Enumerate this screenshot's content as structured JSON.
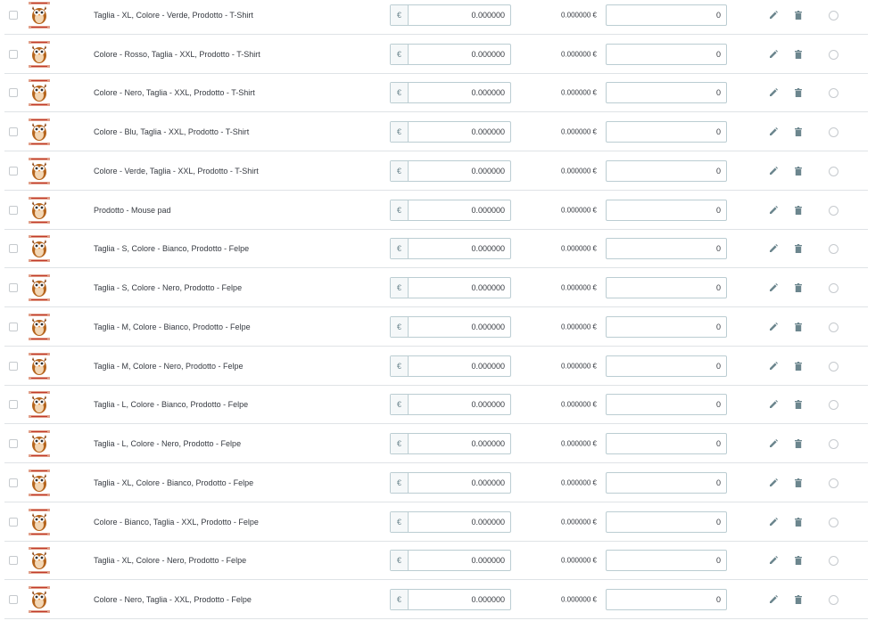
{
  "currency_symbol": "€",
  "rows": [
    {
      "name": "Taglia - XL, Colore - Verde, Prodotto - T-Shirt",
      "impact": "0.000000",
      "final": "0.000000 €",
      "qty": "0"
    },
    {
      "name": "Colore - Rosso, Taglia - XXL, Prodotto - T-Shirt",
      "impact": "0.000000",
      "final": "0.000000 €",
      "qty": "0"
    },
    {
      "name": "Colore - Nero, Taglia - XXL, Prodotto - T-Shirt",
      "impact": "0.000000",
      "final": "0.000000 €",
      "qty": "0"
    },
    {
      "name": "Colore - Blu, Taglia - XXL, Prodotto - T-Shirt",
      "impact": "0.000000",
      "final": "0.000000 €",
      "qty": "0"
    },
    {
      "name": "Colore - Verde, Taglia - XXL, Prodotto - T-Shirt",
      "impact": "0.000000",
      "final": "0.000000 €",
      "qty": "0"
    },
    {
      "name": "Prodotto - Mouse pad",
      "impact": "0.000000",
      "final": "0.000000 €",
      "qty": "0"
    },
    {
      "name": "Taglia - S, Colore - Bianco, Prodotto - Felpe",
      "impact": "0.000000",
      "final": "0.000000 €",
      "qty": "0"
    },
    {
      "name": "Taglia - S, Colore - Nero, Prodotto - Felpe",
      "impact": "0.000000",
      "final": "0.000000 €",
      "qty": "0"
    },
    {
      "name": "Taglia - M, Colore - Bianco, Prodotto - Felpe",
      "impact": "0.000000",
      "final": "0.000000 €",
      "qty": "0"
    },
    {
      "name": "Taglia - M, Colore - Nero, Prodotto - Felpe",
      "impact": "0.000000",
      "final": "0.000000 €",
      "qty": "0"
    },
    {
      "name": "Taglia - L, Colore - Bianco, Prodotto - Felpe",
      "impact": "0.000000",
      "final": "0.000000 €",
      "qty": "0"
    },
    {
      "name": "Taglia - L, Colore - Nero, Prodotto - Felpe",
      "impact": "0.000000",
      "final": "0.000000 €",
      "qty": "0"
    },
    {
      "name": "Taglia - XL, Colore - Bianco, Prodotto - Felpe",
      "impact": "0.000000",
      "final": "0.000000 €",
      "qty": "0"
    },
    {
      "name": "Colore - Bianco, Taglia - XXL, Prodotto - Felpe",
      "impact": "0.000000",
      "final": "0.000000 €",
      "qty": "0"
    },
    {
      "name": "Taglia - XL, Colore - Nero, Prodotto - Felpe",
      "impact": "0.000000",
      "final": "0.000000 €",
      "qty": "0"
    },
    {
      "name": "Colore - Nero, Taglia - XXL, Prodotto - Felpe",
      "impact": "0.000000",
      "final": "0.000000 €",
      "qty": "0"
    }
  ],
  "icons": {
    "thumbnail": "owl-product-image",
    "edit": "pencil-icon",
    "delete": "trash-icon",
    "default": "radio-icon"
  },
  "colors": {
    "border": "#bbcdd2",
    "divider": "#dfe3e6",
    "text": "#363a41",
    "icon": "#6c868e"
  }
}
